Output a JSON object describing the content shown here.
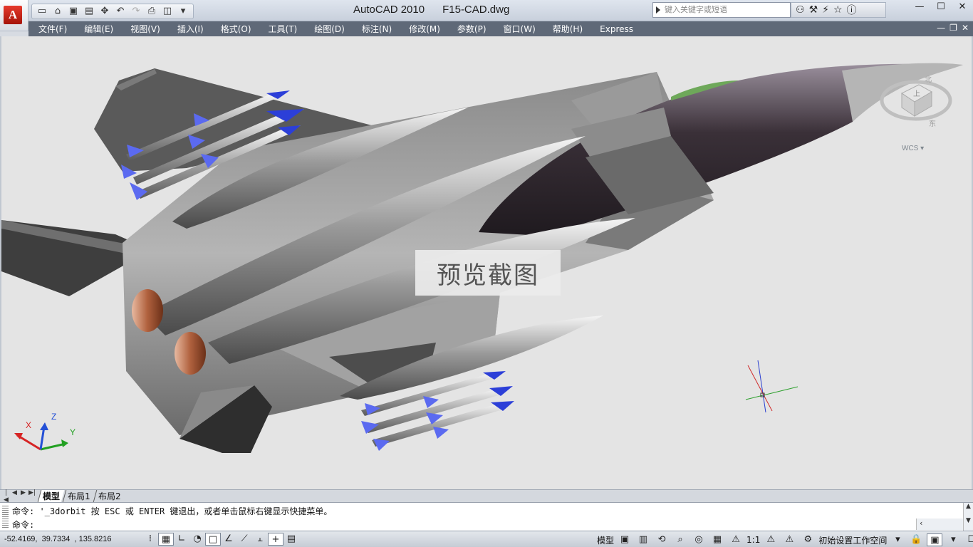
{
  "titlebar": {
    "app_name": "AutoCAD 2010",
    "file_name": "F15-CAD.dwg",
    "search_placeholder": "键入关键字或短语"
  },
  "quick_access": [
    "new-icon",
    "open-icon",
    "save-icon",
    "saveas-icon",
    "pan-icon",
    "undo-icon",
    "redo-icon",
    "plot-icon",
    "preview-icon"
  ],
  "menu": [
    "文件(F)",
    "编辑(E)",
    "视图(V)",
    "插入(I)",
    "格式(O)",
    "工具(T)",
    "绘图(D)",
    "标注(N)",
    "修改(M)",
    "参数(P)",
    "窗口(W)",
    "帮助(H)",
    "Express"
  ],
  "viewport": {
    "preview_label": "预览截图",
    "wcs_label": "WCS",
    "ucs_labels": {
      "x": "X",
      "y": "Y",
      "z": "Z"
    },
    "viewcube_labels": {
      "top": "北",
      "front": "东",
      "face": "上"
    }
  },
  "layout_tabs": [
    {
      "label": "模型",
      "active": true
    },
    {
      "label": "布局1",
      "active": false
    },
    {
      "label": "布局2",
      "active": false
    }
  ],
  "command": {
    "history": "命令: '_3dorbit 按 ESC 或 ENTER 键退出，或者单击鼠标右键显示快捷菜单。",
    "prompt": "命令:"
  },
  "status": {
    "coordinates": "-52.4169,  39.7334  , 135.8216",
    "model_label": "模型",
    "annotation_scale": "1:1",
    "workspace": "初始设置工作空间"
  }
}
